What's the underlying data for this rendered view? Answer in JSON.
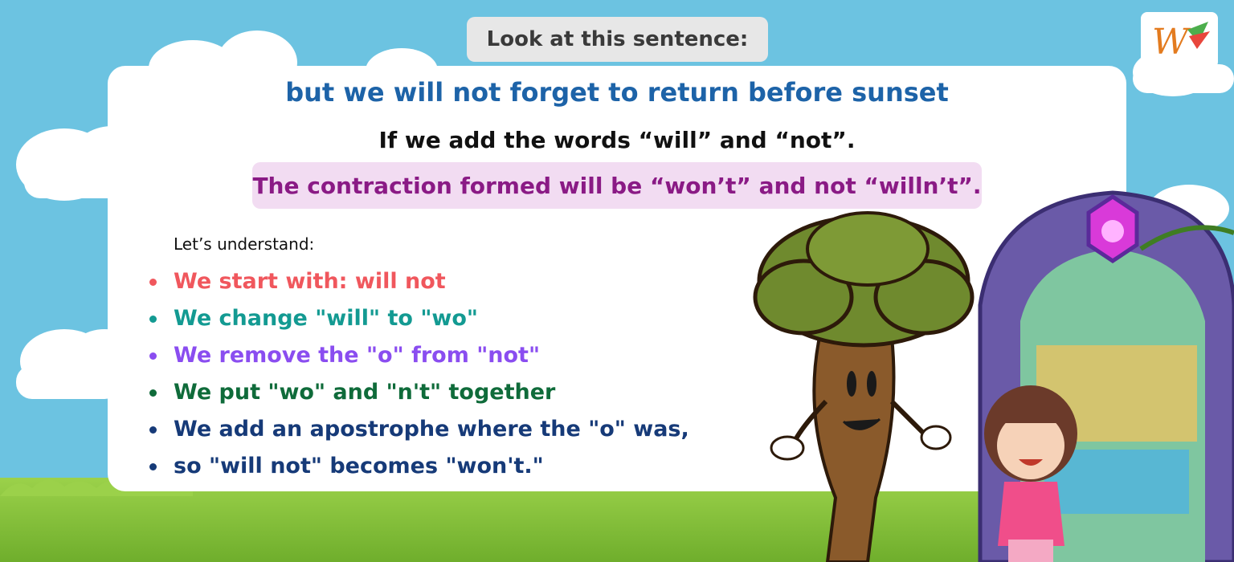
{
  "title": "Look at this sentence:",
  "sentence": "but we will not forget to return before sunset",
  "instruction": "If we add the words “will” and “not”.",
  "highlight": "The contraction formed will be “won’t” and not “willn’t”.",
  "understand_label": "Let’s understand:",
  "steps": [
    {
      "text": "We start with: will not",
      "color": "#f0575d"
    },
    {
      "text": "We change \"will\" to \"wo\"",
      "color": "#139a92"
    },
    {
      "text": "We remove the \"o\" from \"not\"",
      "color": "#8a4df0"
    },
    {
      "text": "We put \"wo\" and \"n't\" together",
      "color": "#0f6b3a"
    },
    {
      "text": "We add an apostrophe where the \"o\" was,",
      "color": "#163a78"
    },
    {
      "text": "so \"will not\" becomes \"won't.\"",
      "color": "#163a78"
    }
  ],
  "colors": {
    "sky": "#6cc3e1",
    "panel": "#ffffff",
    "title_chip": "#e7e7e7",
    "sentence": "#1d63a8",
    "highlight_bg": "#f2dcf2",
    "highlight_text": "#8a1a85"
  },
  "logo": {
    "icon": "w-logo-icon",
    "letter": "W"
  },
  "illustrations": [
    "tree-character",
    "girl-character",
    "magic-portal"
  ]
}
